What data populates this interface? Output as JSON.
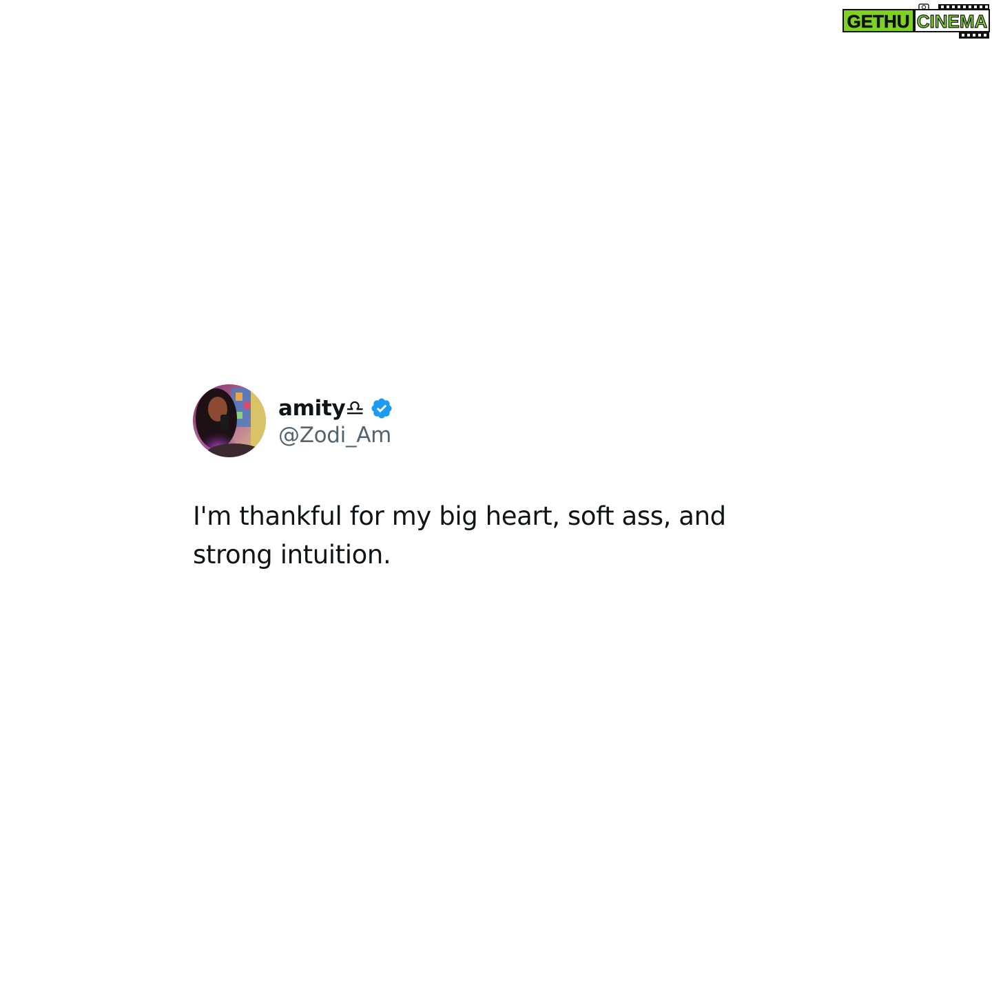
{
  "watermark": {
    "part1": "GETHU",
    "part2": "CINEMA",
    "accent_color": "#7ed321"
  },
  "tweet": {
    "display_name": "amity♎",
    "handle": "@Zodi_Am",
    "verified": true,
    "verified_color": "#1d9bf0",
    "text": "I'm thankful for my big heart, soft ass, and strong intuition."
  },
  "icons": {
    "avatar": "profile-photo",
    "verified": "verified-badge-icon"
  }
}
